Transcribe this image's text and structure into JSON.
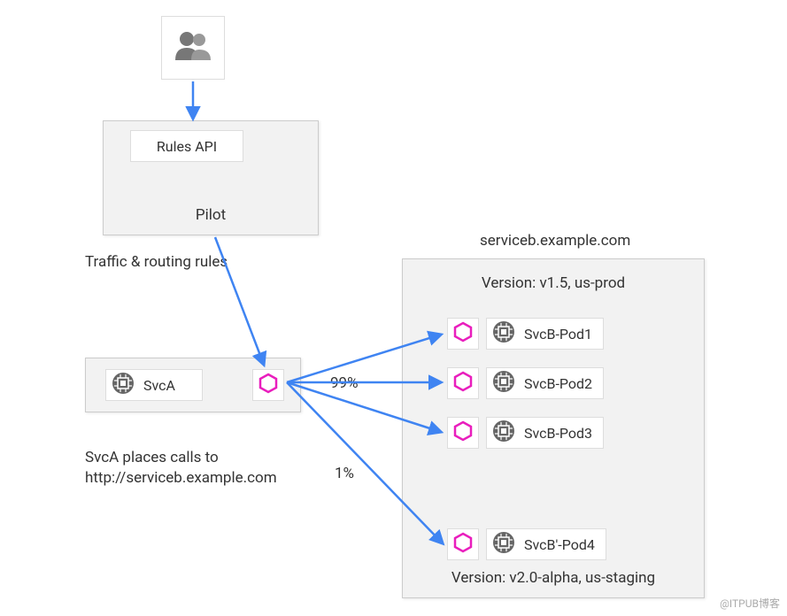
{
  "users_icon": "users-icon",
  "pilot": {
    "title": "Pilot",
    "rules_api": "Rules API"
  },
  "labels": {
    "traffic_rules": "Traffic & routing rules",
    "svca_calls": "SvcA places calls to http://serviceb.example.com",
    "serviceb_host": "serviceb.example.com",
    "version_prod": "Version: v1.5, us-prod",
    "version_staging": "Version: v2.0-alpha, us-staging",
    "pct99": "99%",
    "pct1": "1%"
  },
  "svca": {
    "name": "SvcA"
  },
  "pods": {
    "pod1": "SvcB-Pod1",
    "pod2": "SvcB-Pod2",
    "pod3": "SvcB-Pod3",
    "pod4": "SvcB'-Pod4"
  },
  "watermark": "@ITPUB博客"
}
